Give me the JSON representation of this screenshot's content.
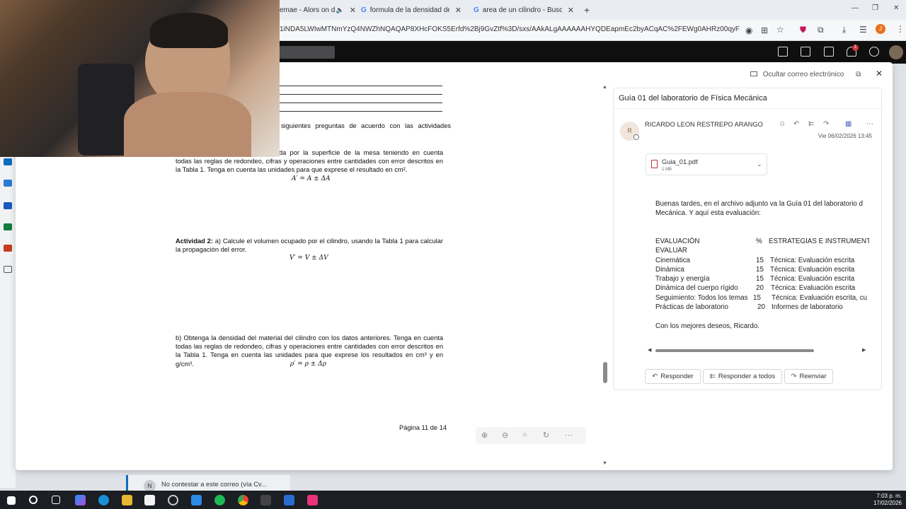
{
  "browser": {
    "tabs": [
      {
        "label": "emae - Alors on dar",
        "close": "✕"
      },
      {
        "label": "formula de la densidad de un c",
        "close": "✕"
      },
      {
        "label": "area de un cilindro - Buscar cor",
        "close": "✕"
      }
    ],
    "new_tab": "+",
    "url": "1iNDA5LWIwMTNmYzQ4NWZhNQAQAP8XHcFOKS5Erfd%2Bj9GvZtf%3D/sxs/AAkALgAAAAAAHYQDEapmEc2byACqAC%2FEWg0AHRz00qyFVkm5m3VLX6j...",
    "profile_initial": "J"
  },
  "app_header": {
    "notification_count": "1"
  },
  "modal": {
    "hide_email": "Ocultar correo electrónico",
    "close": "✕"
  },
  "pdf": {
    "intro_fragment": "siguientes preguntas de acuerdo con las actividades",
    "act1_text": "da por la superficie de la mesa teniendo en cuenta todas las reglas de redondeo, cifras y operaciones entre cantidades con error descritos en la Tabla 1. Tenga en cuenta las unidades para que exprese el resultado en cm².",
    "act1_formula": "A′ = A ± ΔA",
    "act2_label": "Actividad 2:",
    "act2_text": "a) Calcule el volumen ocupado por el cilindro, usando la Tabla 1 para calcular la propagación del error.",
    "act2_formula": "V′ = V ± ΔV",
    "b_text": "b) Obtenga la densidad del material del cilindro con los datos anteriores. Tenga en cuenta todas las reglas de redondeo, cifras y operaciones entre cantidades con error descritos en la Tabla 1. Tenga en cuenta las unidades para que exprese los resultados en cm³ y en g/cm³.",
    "b_formula": "ρ′ = ρ ± Δρ",
    "page_label": "Página 11 de 14"
  },
  "mail": {
    "subject": "Guía 01 del laboratorio de Física Mecánica",
    "sender_initial": "R",
    "sender": "RICARDO LEON RESTREPO ARANGO",
    "date": "Vie 06/02/2026 13:45",
    "attachment": {
      "name": "Guia_01.pdf",
      "size": "1 MB"
    },
    "greeting_1": "Buenas tardes, en el archivo adjunto va la Guía 01 del laboratorio d",
    "greeting_2": "Mecánica. Y aquí esta evaluación:",
    "table_header": {
      "col1": "EVALUACIÓN",
      "col1b": "EVALUAR",
      "col2": "%",
      "col3": "ESTRATEGIAS E INSTRUMENTOS"
    },
    "table_rows": [
      {
        "topic": "Cinemática",
        "pct": "15",
        "strategy": "Técnica: Evaluación escrita"
      },
      {
        "topic": "Dinámica",
        "pct": "15",
        "strategy": "Técnica: Evaluación escrita"
      },
      {
        "topic": "Trabajo y energía",
        "pct": "15",
        "strategy": "Técnica: Evaluación escrita"
      },
      {
        "topic": "Dinámica del cuerpo rígido",
        "pct": "20",
        "strategy": "Técnica: Evaluación escrita"
      },
      {
        "topic": "Seguimiento: Todos los temas",
        "pct": "15",
        "strategy": "Técnica: Evaluación escrita, cu"
      },
      {
        "topic": "Prácticas de laboratorio",
        "pct": "20",
        "strategy": "Informes de laboratorio"
      }
    ],
    "closing": "Con los mejores deseos,  Ricardo.",
    "buttons": {
      "reply": "Responder",
      "reply_all": "Responder a todos",
      "forward": "Reenviar"
    }
  },
  "notification": {
    "initial": "N",
    "text": "No contestar a este correo (vía Cv..."
  },
  "taskbar": {
    "time": "7:03 p. m.",
    "date": "17/02/2026"
  }
}
